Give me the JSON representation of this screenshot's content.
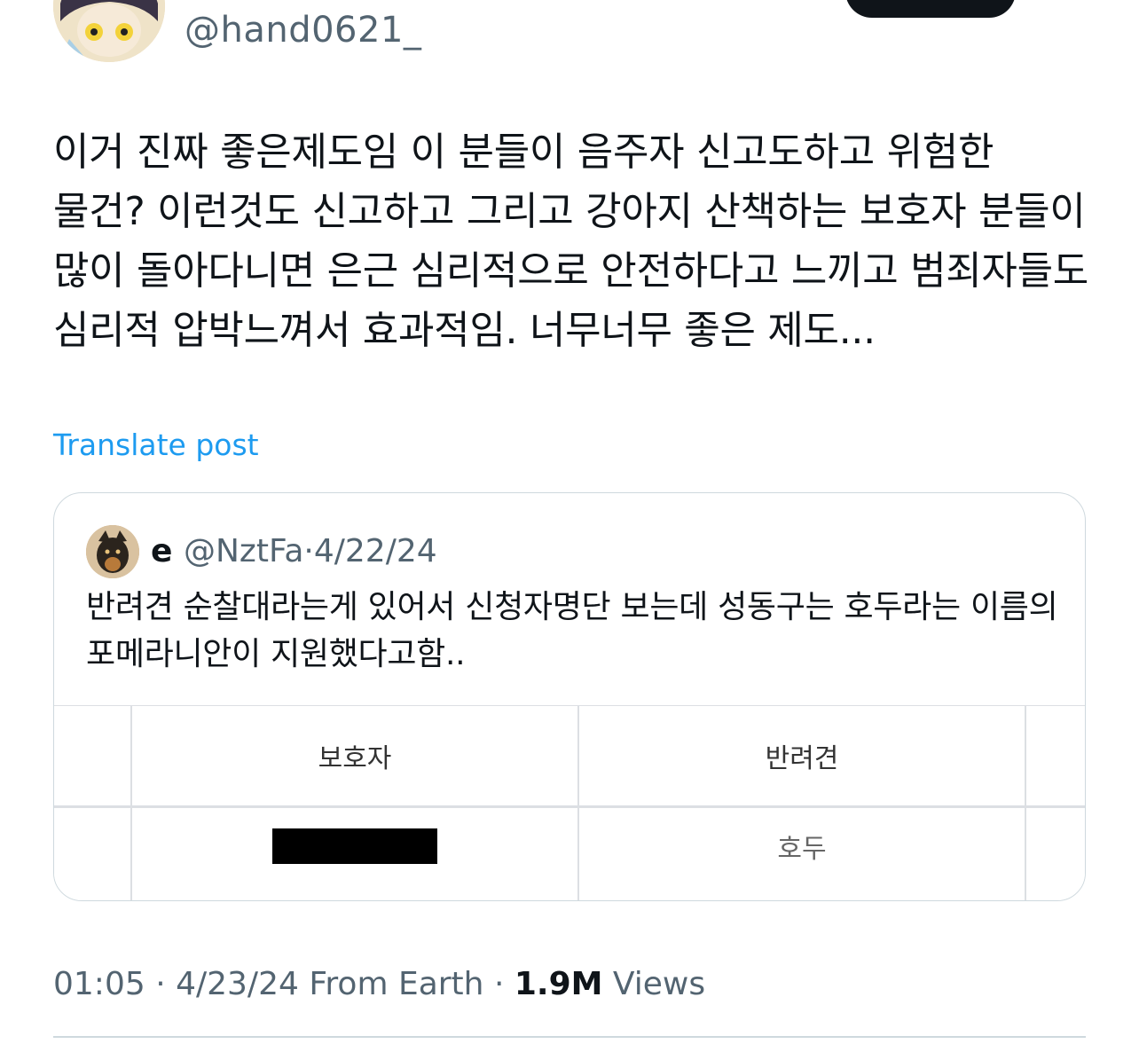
{
  "author": {
    "handle": "@hand0621_",
    "avatar_icon": "anime-avatar-icon"
  },
  "tweet": {
    "text": "이거 진짜 좋은제도임 이 분들이 음주자 신고도하고 위험한 물건? 이런것도 신고하고 그리고 강아지 산책하는 보호자 분들이 많이 돌아다니면 은근 심리적으로 안전하다고 느끼고 범죄자들도 심리적 압박느껴서 효과적임. 너무너무 좋은 제도...",
    "translate_label": "Translate post"
  },
  "quote": {
    "name": "e",
    "handle": "@NztFa",
    "separator": "·",
    "date": "4/22/24",
    "text": "반려견 순찰대라는게 있어서 신청자명단 보는데 성동구는 호두라는 이름의 포메라니안이 지원했다고함..",
    "avatar_icon": "dog-avatar-icon",
    "table": {
      "headers": [
        "보호자",
        "반려견"
      ],
      "rows": [
        [
          "[redacted]",
          "호두"
        ]
      ]
    }
  },
  "meta": {
    "time": "01:05",
    "sep1": " · ",
    "date": "4/23/24",
    "location": " From Earth",
    "sep2": " · ",
    "views_count": "1.9M",
    "views_label": " Views"
  },
  "colors": {
    "accent": "#1d9bf0",
    "text": "#0f1419",
    "muted": "#536471",
    "border": "#cfd9de"
  }
}
